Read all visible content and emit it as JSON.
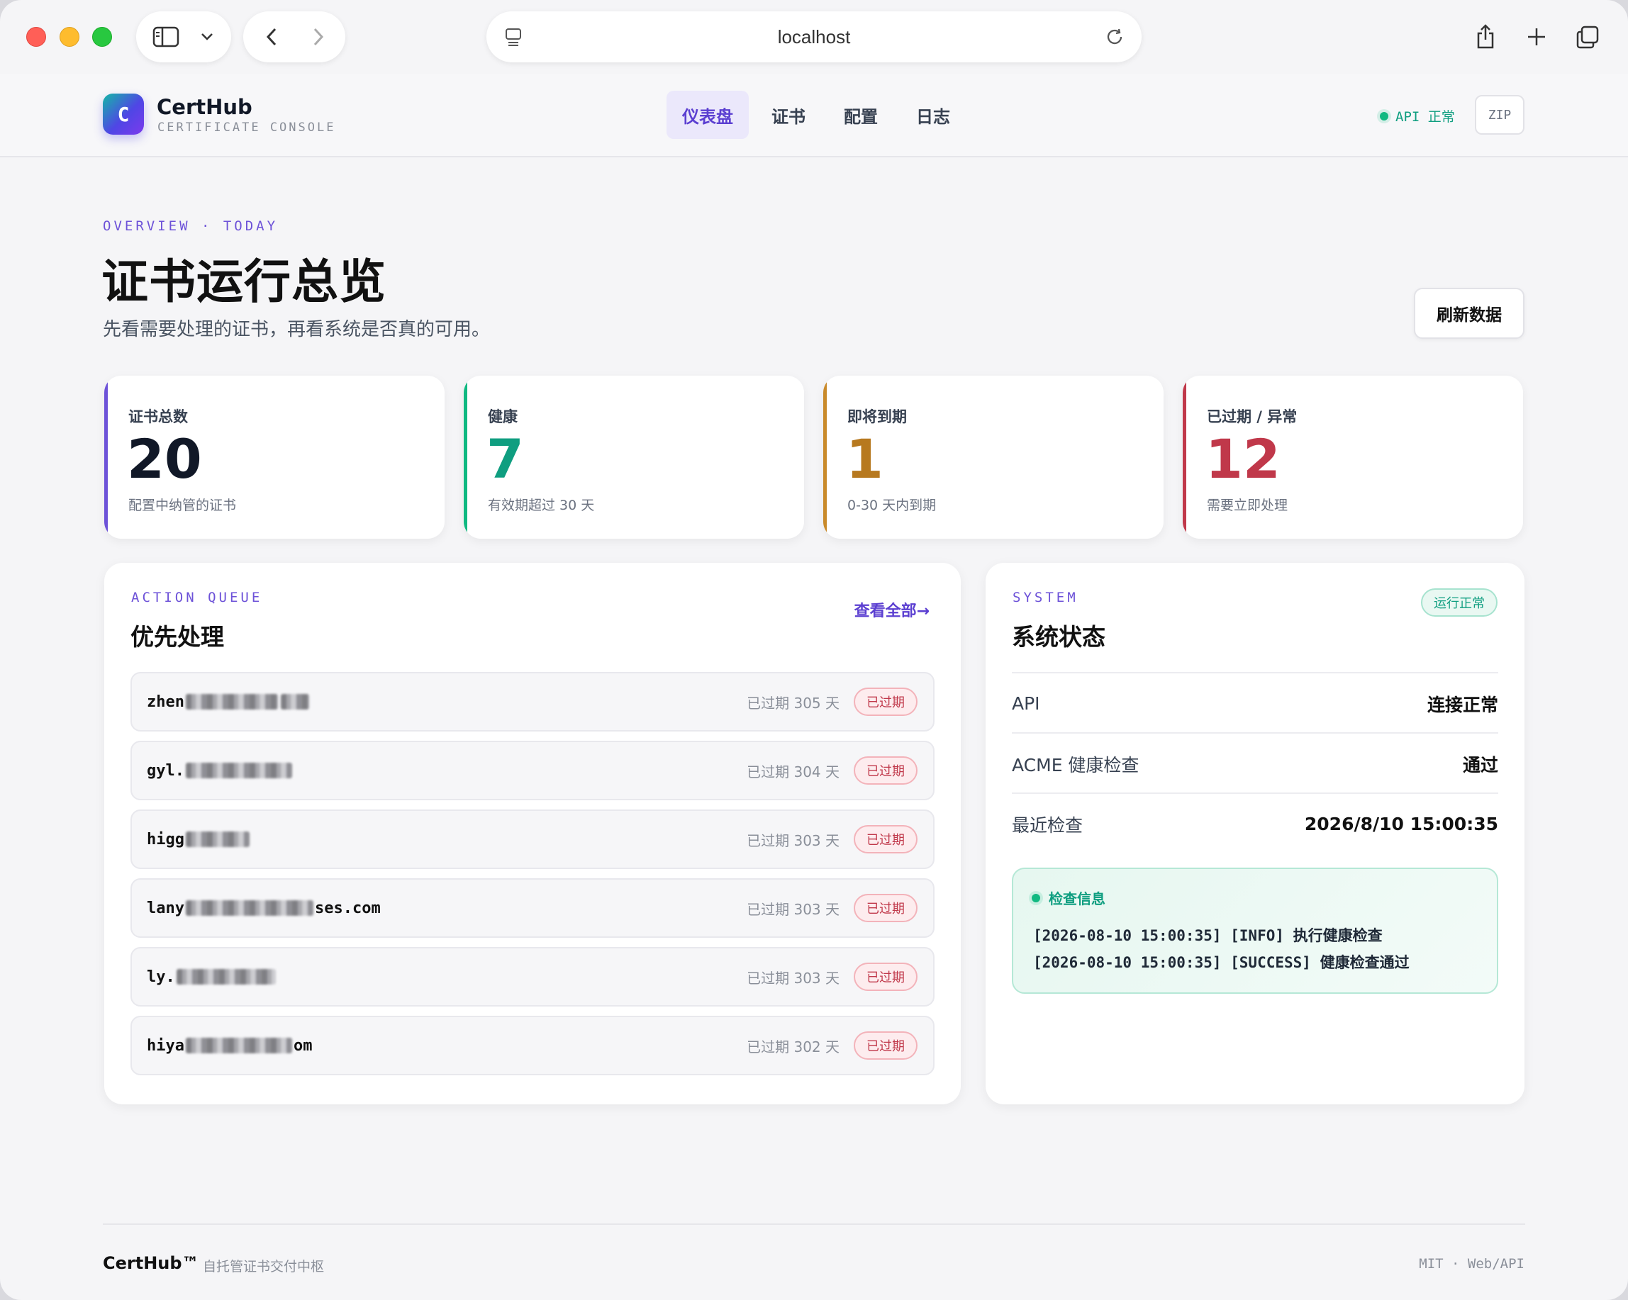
{
  "browser": {
    "url": "localhost"
  },
  "header": {
    "logo_letter": "C",
    "brand_name": "CertHub",
    "brand_sub": "CERTIFICATE CONSOLE",
    "nav": [
      "仪表盘",
      "证书",
      "配置",
      "日志"
    ],
    "active_nav": "仪表盘",
    "api_status": "API 正常",
    "zip_label": "ZIP"
  },
  "page": {
    "eyebrow": "OVERVIEW · TODAY",
    "title": "证书运行总览",
    "subtitle": "先看需要处理的证书，再看系统是否真的可用。",
    "refresh_label": "刷新数据"
  },
  "stats": [
    {
      "label": "证书总数",
      "value": "20",
      "desc": "配置中纳管的证书",
      "color": "#111827",
      "accent": "#6d52d8"
    },
    {
      "label": "健康",
      "value": "7",
      "desc": "有效期超过 30 天",
      "color": "#0f9e80",
      "accent": "#10b981"
    },
    {
      "label": "即将到期",
      "value": "1",
      "desc": "0-30 天内到期",
      "color": "#b7791f",
      "accent": "#c98a2a"
    },
    {
      "label": "已过期 / 异常",
      "value": "12",
      "desc": "需要立即处理",
      "color": "#c0384a",
      "accent": "#c0384a"
    }
  ],
  "queue": {
    "eyebrow": "ACTION QUEUE",
    "title": "优先处理",
    "view_all": "查看全部→",
    "items": [
      {
        "domain_prefix": "zhen",
        "domain_suffix": "",
        "days": "已过期 305 天",
        "badge": "已过期"
      },
      {
        "domain_prefix": "gyl.",
        "domain_suffix": "",
        "days": "已过期 304 天",
        "badge": "已过期"
      },
      {
        "domain_prefix": "higg",
        "domain_suffix": "",
        "days": "已过期 303 天",
        "badge": "已过期"
      },
      {
        "domain_prefix": "lany",
        "domain_suffix": "ses.com",
        "days": "已过期 303 天",
        "badge": "已过期"
      },
      {
        "domain_prefix": "ly.",
        "domain_suffix": "",
        "days": "已过期 303 天",
        "badge": "已过期"
      },
      {
        "domain_prefix": "hiya",
        "domain_suffix": "om",
        "days": "已过期 302 天",
        "badge": "已过期"
      }
    ]
  },
  "system": {
    "eyebrow": "SYSTEM",
    "title": "系统状态",
    "badge": "运行正常",
    "rows": [
      {
        "key": "API",
        "value": "连接正常"
      },
      {
        "key": "ACME 健康检查",
        "value": "通过"
      },
      {
        "key": "最近检查",
        "value": "2026/8/10 15:00:35"
      }
    ],
    "log_title": "检查信息",
    "log_lines": [
      "[2026-08-10 15:00:35] [INFO] 执行健康检查",
      "[2026-08-10 15:00:35] [SUCCESS] 健康检查通过"
    ]
  },
  "footer": {
    "brand": "CertHub™",
    "tagline": "自托管证书交付中枢",
    "right": "MIT · Web/API"
  }
}
